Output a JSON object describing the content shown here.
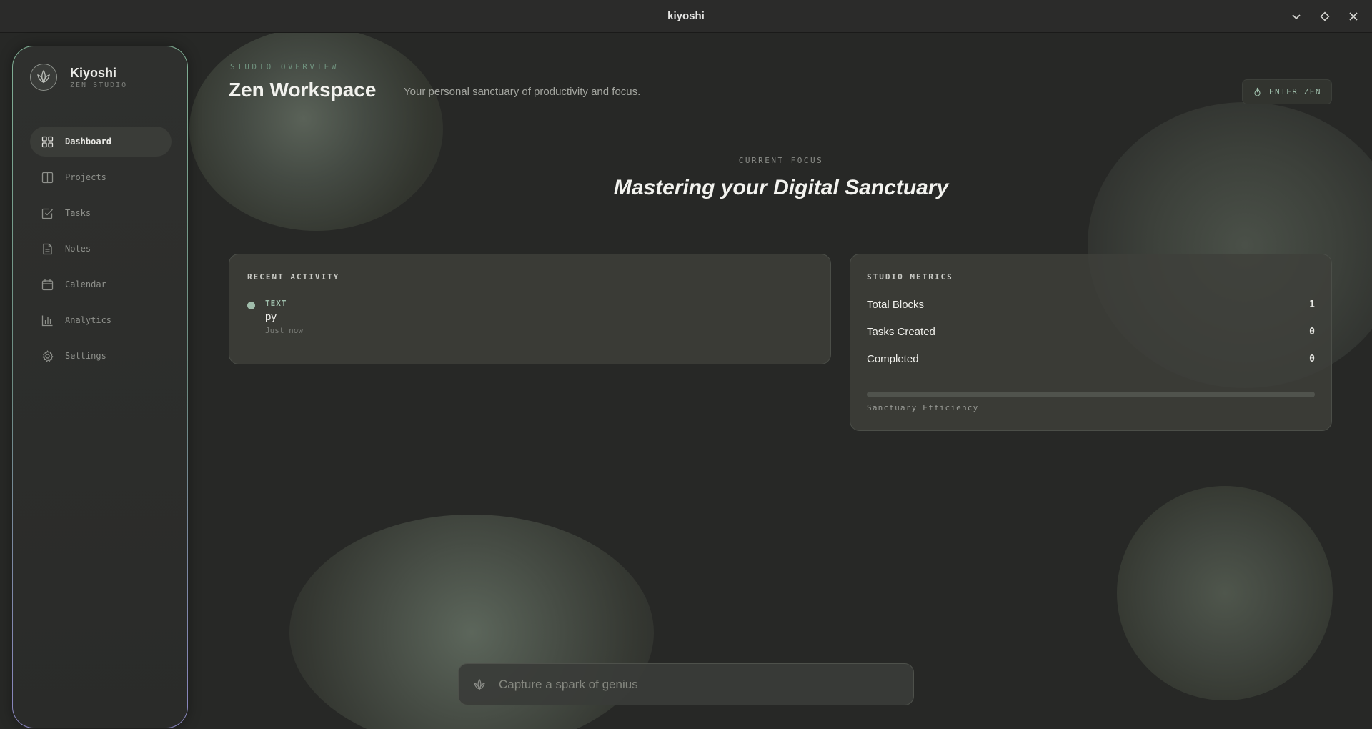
{
  "window": {
    "title": "kiyoshi",
    "controls": [
      {
        "name": "minimize",
        "icon": "chevron-down-icon"
      },
      {
        "name": "maximize",
        "icon": "diamond-icon"
      },
      {
        "name": "close",
        "icon": "close-icon"
      }
    ]
  },
  "sidebar": {
    "brand_name": "Kiyoshi",
    "brand_sub": "ZEN STUDIO",
    "items": [
      {
        "label": "Dashboard",
        "icon": "grid-icon",
        "active": true
      },
      {
        "label": "Projects",
        "icon": "columns-icon",
        "active": false
      },
      {
        "label": "Tasks",
        "icon": "checkbox-icon",
        "active": false
      },
      {
        "label": "Notes",
        "icon": "document-icon",
        "active": false
      },
      {
        "label": "Calendar",
        "icon": "calendar-icon",
        "active": false
      },
      {
        "label": "Analytics",
        "icon": "bar-chart-icon",
        "active": false
      },
      {
        "label": "Settings",
        "icon": "gear-icon",
        "active": false
      }
    ]
  },
  "header": {
    "overview_label": "STUDIO OVERVIEW",
    "title": "Zen Workspace",
    "subtitle": "Your personal sanctuary of productivity and focus.",
    "enter_zen_label": "ENTER ZEN"
  },
  "focus": {
    "label": "CURRENT FOCUS",
    "title": "Mastering your Digital Sanctuary"
  },
  "recent_activity": {
    "title": "RECENT ACTIVITY",
    "items": [
      {
        "type": "TEXT",
        "text": "py",
        "time": "Just now"
      }
    ]
  },
  "metrics": {
    "title": "STUDIO METRICS",
    "rows": [
      {
        "label": "Total Blocks",
        "value": "1"
      },
      {
        "label": "Tasks Created",
        "value": "0"
      },
      {
        "label": "Completed",
        "value": "0"
      }
    ],
    "efficiency_label": "Sanctuary Efficiency",
    "efficiency_fraction": 0
  },
  "capture": {
    "placeholder": "Capture a spark of genius",
    "value": ""
  },
  "colors": {
    "accent": "#9fbfac",
    "background": "#272826"
  }
}
